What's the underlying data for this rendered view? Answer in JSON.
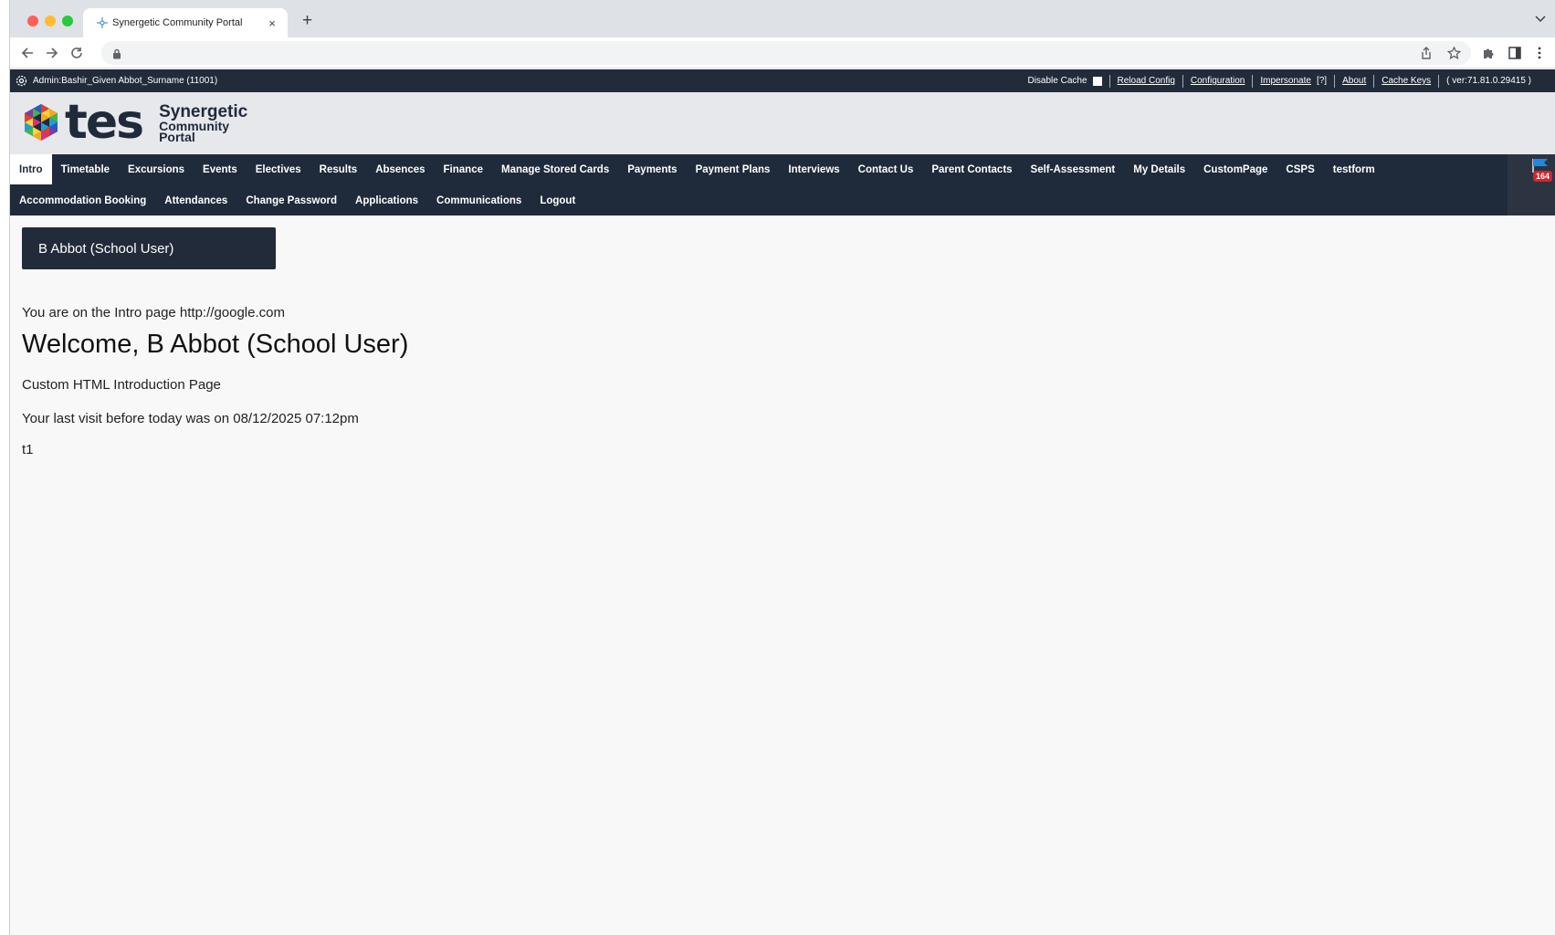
{
  "browser": {
    "tab_title": "Synergetic Community Portal",
    "tab_close": "×",
    "new_tab": "+"
  },
  "adminbar": {
    "user_label": "Admin:Bashir_Given Abbot_Surname (11001)",
    "disable_cache": "Disable Cache",
    "reload_config": "Reload Config",
    "configuration": "Configuration",
    "impersonate": "Impersonate",
    "impersonate_help": "[?]",
    "about": "About",
    "cache_keys": "Cache Keys",
    "version": "( ver:71.81.0.29415 )"
  },
  "logo": {
    "tes": "tes",
    "line1": "Synergetic",
    "line2": "Community",
    "line3": "Portal"
  },
  "nav": {
    "row1": [
      "Intro",
      "Timetable",
      "Excursions",
      "Events",
      "Electives",
      "Results",
      "Absences",
      "Finance",
      "Manage Stored Cards",
      "Payments",
      "Payment Plans",
      "Interviews",
      "Contact Us",
      "Parent Contacts",
      "Self-Assessment",
      "My Details",
      "CustomPage",
      "CSPS",
      "testform"
    ],
    "row2": [
      "Accommodation Booking",
      "Attendances",
      "Change Password",
      "Applications",
      "Communications",
      "Logout"
    ],
    "active": "Intro",
    "flag_count": "164"
  },
  "content": {
    "user_banner": "B Abbot (School User)",
    "intro_line": "You are on the Intro page http://google.com",
    "welcome": "Welcome, B Abbot (School User)",
    "custom_line": "Custom HTML Introduction Page",
    "last_visit": "Your last visit before today was on 08/12/2025 07:12pm",
    "t1": "t1"
  },
  "colors": {
    "nav_bg": "#1f2a3a",
    "header_bg": "#e6e8ec",
    "flag_badge": "#d6232b"
  }
}
